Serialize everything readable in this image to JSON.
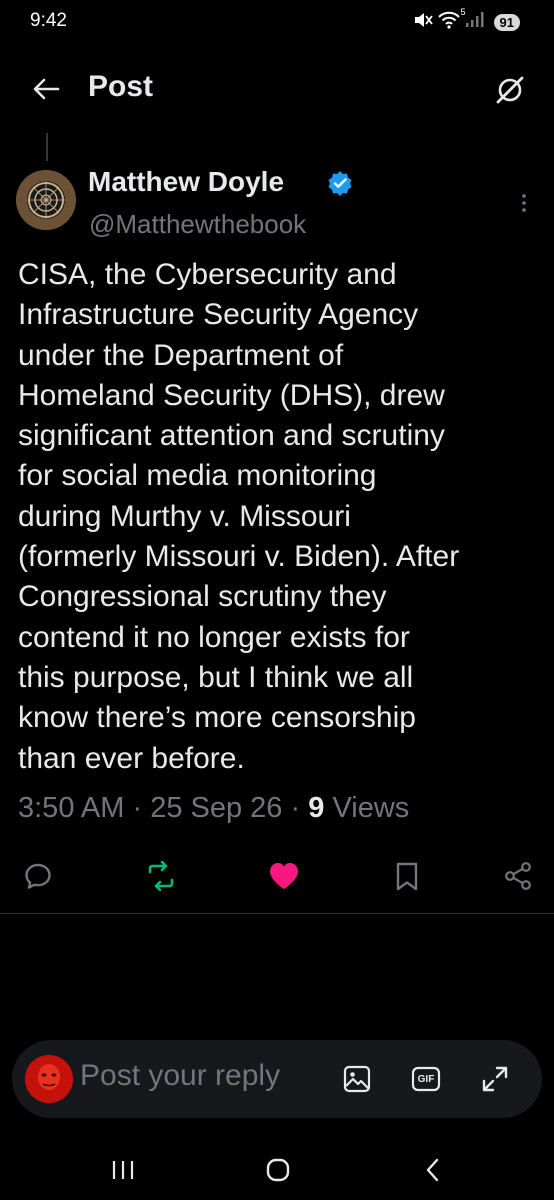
{
  "status_bar": {
    "time": "9:42",
    "battery": "91",
    "wifi_label": "5"
  },
  "header": {
    "title": "Post",
    "back_icon": "arrow-left-icon",
    "grok_icon": "grok-icon"
  },
  "post": {
    "author_name": "Matthew Doyle",
    "author_handle": "@Matthewthebook",
    "verified": true,
    "text": "CISA, the Cybersecurity and\nInfrastructure Security Agency\nunder the Department of\nHomeland Security (DHS), drew\nsignificant attention and scrutiny\nfor social media monitoring\nduring Murthy v. Missouri\n(formerly Missouri v. Biden). After\nCongressional scrutiny they\ncontend it no longer exists for\nthis purpose, but I think we all\nknow there’s more censorship\nthan ever before.",
    "time": "3:50 AM",
    "separator": "·",
    "date": "25 Sep 26",
    "views_count": "9",
    "views_label": "Views"
  },
  "actions": {
    "reply_icon": "reply-icon",
    "repost_icon": "repost-icon",
    "like_icon": "heart-icon",
    "bookmark_icon": "bookmark-icon",
    "share_icon": "share-icon"
  },
  "colors": {
    "background": "#000000",
    "text": "#e7e9ea",
    "secondary_text": "#71767b",
    "verified_blue": "#1d9bf0",
    "repost_green": "#00ba7c",
    "like_pink": "#f91880",
    "reply_bar_bg": "#16181c"
  },
  "reply": {
    "placeholder": "Post your reply",
    "gif_label": "GIF"
  }
}
